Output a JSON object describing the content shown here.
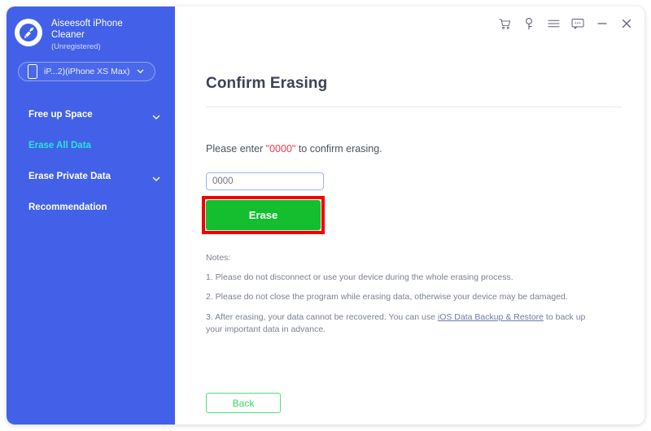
{
  "window": {
    "title_icons": [
      {
        "name": "cart-icon",
        "label": "Buy"
      },
      {
        "name": "key-icon",
        "label": "Register"
      },
      {
        "name": "menu-icon",
        "label": "Menu"
      },
      {
        "name": "feedback-icon",
        "label": "Feedback"
      },
      {
        "name": "minimize-icon",
        "label": "Minimize"
      },
      {
        "name": "close-icon",
        "label": "Close"
      }
    ]
  },
  "sidebar": {
    "brand": {
      "logo_icon": "broom-logo-icon",
      "name_line1": "Aiseesoft iPhone",
      "name_line2": "Cleaner",
      "registration": "(Unregistered)"
    },
    "device": {
      "icon": "phone-icon",
      "label": "iP...2)(iPhone XS Max)",
      "chevron": "chevron-down-icon"
    },
    "items": [
      {
        "label": "Free up Space",
        "active": false,
        "expandable": true
      },
      {
        "label": "Erase All Data",
        "active": true,
        "expandable": false
      },
      {
        "label": "Erase Private Data",
        "active": false,
        "expandable": true
      },
      {
        "label": "Recommendation",
        "active": false,
        "expandable": false
      }
    ],
    "colors": {
      "background": "#4361e8",
      "active_text": "#27e5d8"
    }
  },
  "main": {
    "page_title": "Confirm Erasing",
    "instruction": {
      "prefix": "Please enter ",
      "code": "\"0000\"",
      "suffix": " to confirm erasing."
    },
    "code_input": {
      "value": "0000",
      "placeholder": "0000"
    },
    "erase_button": {
      "label": "Erase",
      "color": "#13bf2e"
    },
    "highlight": {
      "color": "#f40000"
    },
    "notes": {
      "title": "Notes:",
      "items": [
        "1. Please do not disconnect or use your device during the whole erasing process.",
        "2. Please do not close the program while erasing data, otherwise your device may be damaged."
      ],
      "note3_prefix": "3. After erasing, your data cannot be recovered. You can use ",
      "note3_link": "iOS Data Backup & Restore",
      "note3_suffix": " to back up your important data in advance."
    },
    "back_button": {
      "label": "Back",
      "color": "#35d662"
    }
  }
}
